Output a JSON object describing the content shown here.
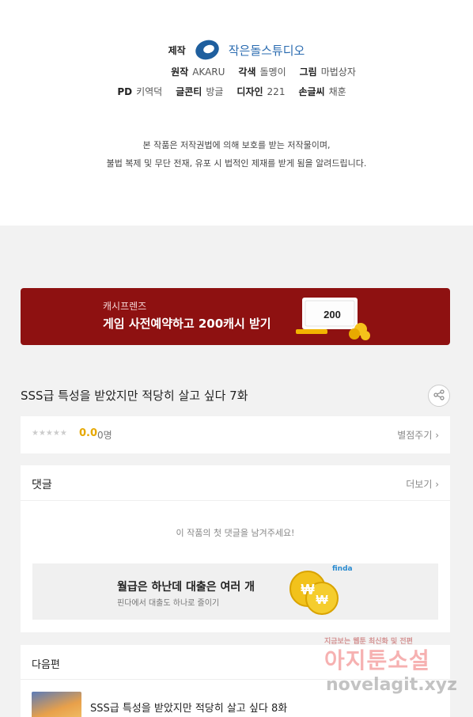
{
  "credits": {
    "production_label": "제작",
    "studio_name": "작은돌스튜디오",
    "original_label": "원작",
    "original_value": "AKARU",
    "adapt_label": "각색",
    "adapt_value": "돌멩이",
    "art_label": "그림",
    "art_value": "마법상자",
    "pd_label": "PD",
    "pd_value": "키역덕",
    "cont_label": "글콘티",
    "cont_value": "방글",
    "design_label": "디자인",
    "design_value": "221",
    "lettering_label": "손글씨",
    "lettering_value": "채훈",
    "notice_line1": "본 작품은 저작권법에 의해 보호를 받는 저작물이며,",
    "notice_line2": "불법 복제 및 무단 전재, 유포 시 법적인 제재를 받게 됨을 알려드립니다."
  },
  "banner": {
    "subtitle": "캐시프렌즈",
    "title": "게임 사전예약하고 200캐시 받기",
    "ticket_amount": "200",
    "bg_color": "#8e1111"
  },
  "episode": {
    "title": "SSS급 특성을 받았지만 적당히 살고 싶다 7화",
    "share_icon": "share-icon"
  },
  "rating": {
    "stars": "★★★★★",
    "score": "0.0",
    "count": "0명",
    "rate_link": "별점주기 ›"
  },
  "comments": {
    "header": "댓글",
    "more_link": "더보기 ›",
    "empty_message": "이 작품의 첫 댓글을 남겨주세요!",
    "ad": {
      "title": "월급은 하난데 대출은 여러 개",
      "subtitle": "핀다에서 대출도 하나로 줄이기",
      "brand": "finda"
    }
  },
  "next_episode": {
    "header": "다음편",
    "title": "SSS급 특성을 받았지만 적당히 살고 싶다 8화"
  },
  "watermark": {
    "top": "지금보는 웹툰 최신화 및 전편",
    "main": "아지툰소설",
    "url": "novelagit.xyz"
  }
}
